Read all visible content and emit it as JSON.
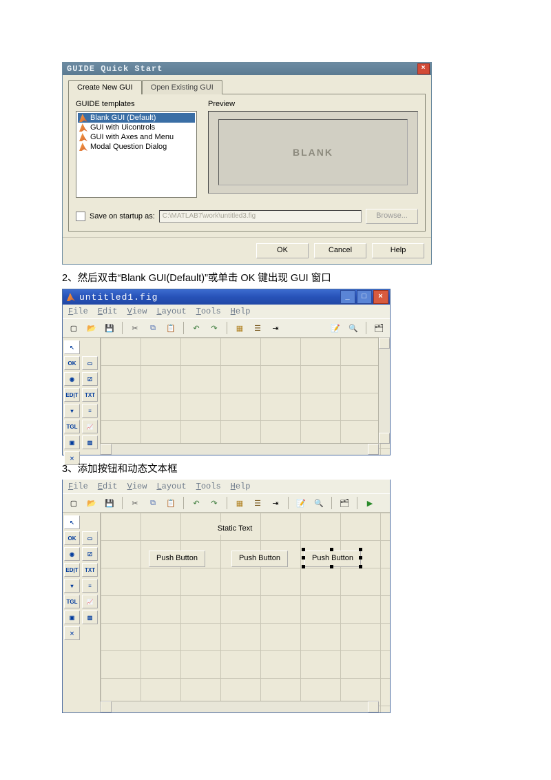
{
  "fig1": {
    "title": "GUIDE Quick Start",
    "tab_create": "Create New GUI",
    "tab_open": "Open Existing GUI",
    "templates_label": "GUIDE templates",
    "templates": [
      "Blank GUI (Default)",
      "GUI with Uicontrols",
      "GUI with Axes and Menu",
      "Modal Question Dialog"
    ],
    "preview_label": "Preview",
    "preview_text": "BLANK",
    "save_label": "Save on startup as:",
    "save_path": "C:\\MATLAB7\\work\\untitled3.fig",
    "browse": "Browse...",
    "ok": "OK",
    "cancel": "Cancel",
    "help": "Help"
  },
  "caption1": "2、然后双击“Blank GUI(Default)”或单击 OK 键出现 GUI 窗口",
  "fig2": {
    "title": "untitled1.fig",
    "menu": {
      "file": "File",
      "edit": "Edit",
      "view": "View",
      "layout": "Layout",
      "tools": "Tools",
      "help": "Help"
    }
  },
  "caption2": "3、添加按钮和动态文本框",
  "fig3": {
    "menu": {
      "file": "File",
      "edit": "Edit",
      "view": "View",
      "layout": "Layout",
      "tools": "Tools",
      "help": "Help"
    },
    "static_text": "Static Text",
    "pb1": "Push Button",
    "pb2": "Push Button",
    "pb3": "Push Button"
  }
}
